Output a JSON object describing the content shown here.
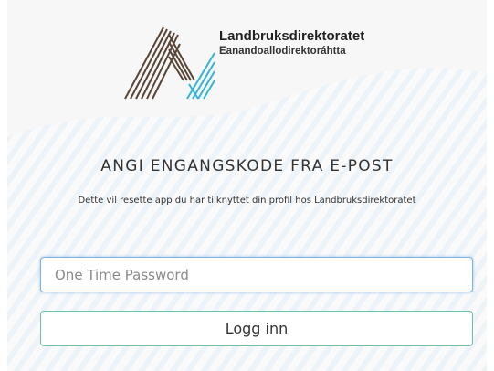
{
  "organization": {
    "name": "Landbruksdirektoratet",
    "name_sami": "Eanandoallodirektoráhtta"
  },
  "page": {
    "heading": "ANGI ENGANGSKODE FRA E-POST",
    "description": "Dette vil resette app du har tilknyttet din profil hos Landbruksdirektoratet"
  },
  "form": {
    "otp_placeholder": "One Time Password",
    "otp_value": "",
    "submit_label": "Logg inn"
  },
  "colors": {
    "background": "#f7f7f7",
    "logo_brown": "#5a4436",
    "logo_blue": "#35b4d6",
    "input_border": "#7eb4e0",
    "button_border": "#6cc3a6"
  }
}
